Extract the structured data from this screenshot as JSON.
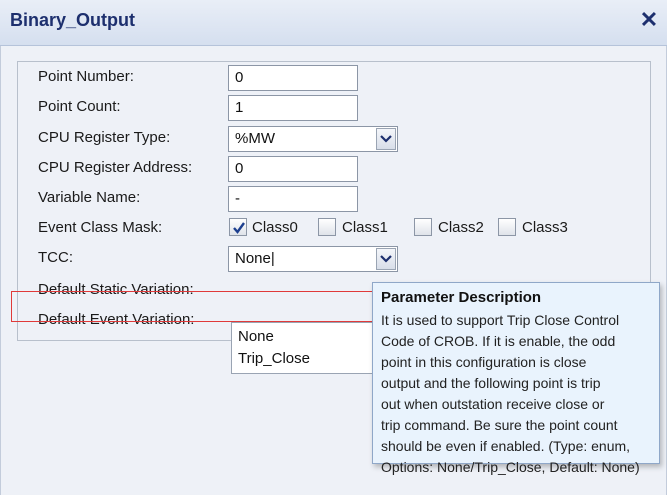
{
  "window": {
    "title": "Binary_Output",
    "close_glyph": "✕"
  },
  "fields": {
    "point_number": {
      "label": "Point Number:",
      "value": "0"
    },
    "point_count": {
      "label": "Point Count:",
      "value": "1"
    },
    "cpu_register_type": {
      "label": "CPU Register Type:",
      "value": "%MW"
    },
    "cpu_register_address": {
      "label": "CPU Register Address:",
      "value": "0"
    },
    "variable_name": {
      "label": "Variable Name:",
      "value": "-"
    },
    "event_class_mask": {
      "label": "Event Class Mask:",
      "options": [
        {
          "label": "Class0",
          "checked": true
        },
        {
          "label": "Class1",
          "checked": false
        },
        {
          "label": "Class2",
          "checked": false
        },
        {
          "label": "Class3",
          "checked": false
        }
      ]
    },
    "tcc": {
      "label": "TCC:",
      "value": "None|"
    },
    "default_static_variation": {
      "label": "Default Static Variation:"
    },
    "default_event_variation": {
      "label": "Default Event Variation:"
    }
  },
  "tcc_dropdown": {
    "options": [
      "None",
      "Trip_Close"
    ]
  },
  "tooltip": {
    "title": "Parameter Description",
    "lines": [
      "It is used to support Trip Close Control",
      "Code of CROB. If it is enable, the odd",
      "point in this configuration is close",
      "output and the following point is trip",
      "out when outstation receive close or",
      "trip command. Be sure the point count",
      "should be even if enabled. (Type: enum,",
      "Options: None/Trip_Close, Default: None)"
    ]
  },
  "colors": {
    "highlight": "#e03a3a",
    "title_text": "#1d2f6e",
    "tooltip_bg": "#e9f3fd"
  },
  "icons": {
    "close": "close-icon",
    "dropdown": "chevron-down-icon",
    "check": "checkmark-icon"
  }
}
